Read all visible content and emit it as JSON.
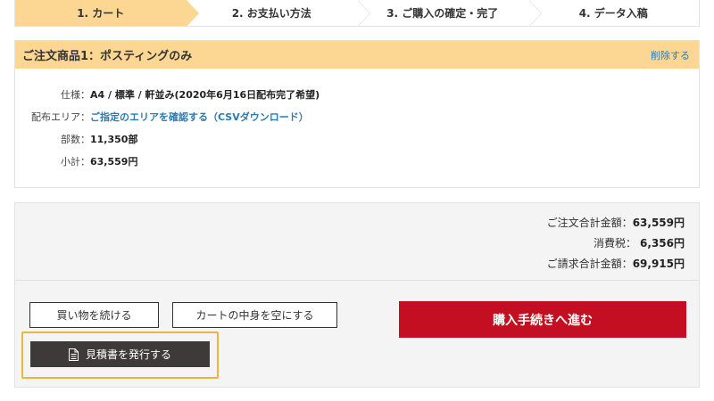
{
  "steps": [
    {
      "label": "1. カート",
      "active": true
    },
    {
      "label": "2. お支払い方法",
      "active": false
    },
    {
      "label": "3. ご購入の確定・完了",
      "active": false
    },
    {
      "label": "4. データ入稿",
      "active": false
    }
  ],
  "product": {
    "title": "ご注文商品1：ポスティングのみ",
    "delete_label": "削除する",
    "spec_label": "仕様：",
    "spec_value": "A4 / 標準 / 軒並み(2020年6月16日配布完了希望)",
    "area_label": "配布エリア：",
    "area_link": "ご指定のエリアを確認する（CSVダウンロード）",
    "count_label": "部数：",
    "count_value": "11,350部",
    "subtotal_label": "小計：",
    "subtotal_value": "63,559円"
  },
  "totals": {
    "order_total_label": "ご注文合計金額：",
    "order_total_value": "63,559円",
    "tax_label": "消費税：",
    "tax_value": "6,356円",
    "billing_total_label": "ご請求合計金額：",
    "billing_total_value": "69,915円"
  },
  "buttons": {
    "continue_label": "買い物を続ける",
    "empty_cart_label": "カートの中身を空にする",
    "purchase_label": "購入手続きへ進む",
    "estimate_label": "見積書を発行する"
  },
  "colors": {
    "accent": "#fbd793",
    "primary_button": "#c40f22",
    "dark_button": "#3e3a39",
    "highlight": "#f0b43c",
    "link": "#2a7bb3"
  },
  "icons": {
    "estimate_icon": "document-icon"
  }
}
